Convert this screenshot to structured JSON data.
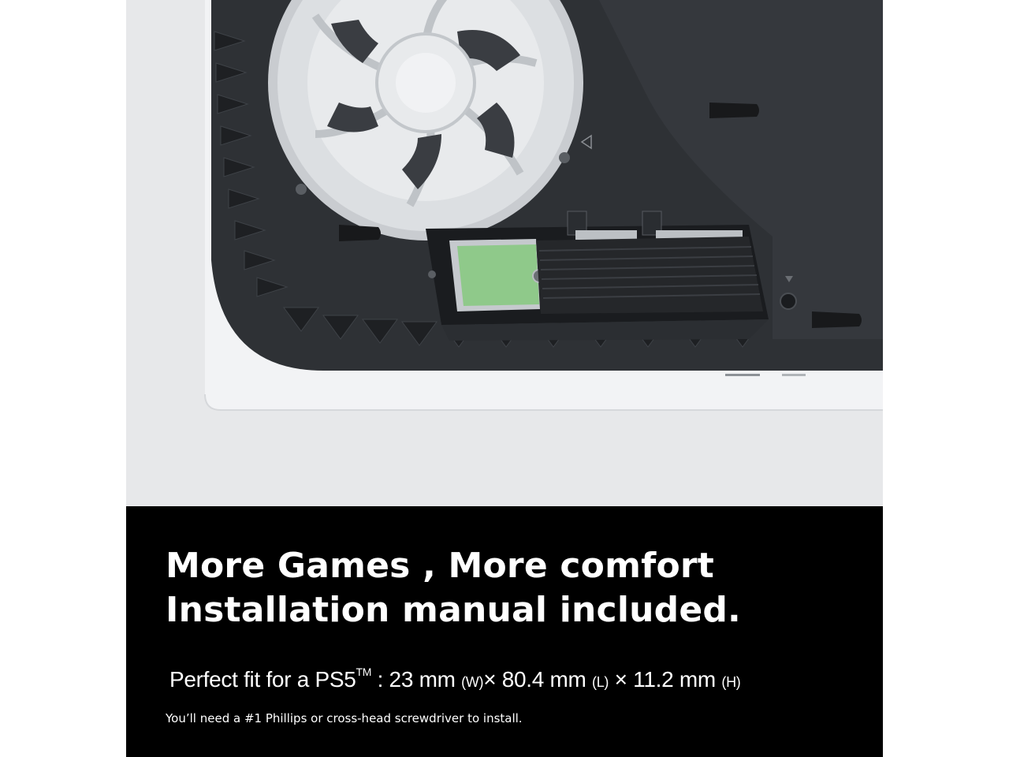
{
  "caption": {
    "headline_line1": "More Games , More comfort",
    "headline_line2": "Installation manual included.",
    "spec": {
      "prefix": "Perfect fit for a PS5",
      "trademark": "TM",
      "width_value": " : 23 mm ",
      "width_unit": "(W)",
      "length_value": "× 80.4 mm ",
      "length_unit": "(L)",
      "height_value": " × 11.2 mm ",
      "height_unit": "(H)"
    },
    "note": "You’ll need a #1 Phillips or cross-head screwdriver to install."
  },
  "colors": {
    "caption_background": "#000000",
    "caption_text": "#ffffff",
    "photo_background": "#e6e7e9",
    "console_shell": "#f2f3f5",
    "console_body": "#2e3135",
    "fan": "#d8dbde",
    "ssd_board": "#8fc98a",
    "heatsink": "#25272a"
  }
}
